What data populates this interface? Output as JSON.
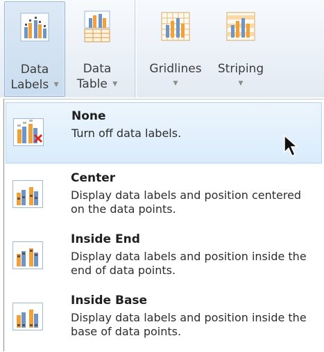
{
  "ribbon": {
    "data_labels": {
      "line1": "Data",
      "line2": "Labels",
      "icon": "data-labels-icon"
    },
    "data_table": {
      "line1": "Data",
      "line2": "Table",
      "icon": "data-table-icon"
    },
    "gridlines": {
      "label": "Gridlines",
      "icon": "gridlines-icon"
    },
    "striping": {
      "label": "Striping",
      "icon": "striping-icon"
    },
    "dropdown_glyph": "▼"
  },
  "menu": {
    "items": [
      {
        "title": "None",
        "description": "Turn off data labels.",
        "icon": "no-labels-icon",
        "selected": true
      },
      {
        "title": "Center",
        "description": "Display data labels and position centered on the data points.",
        "icon": "center-labels-icon",
        "selected": false
      },
      {
        "title": "Inside End",
        "description": "Display data labels and position inside the end of data points.",
        "icon": "inside-end-labels-icon",
        "selected": false
      },
      {
        "title": "Inside Base",
        "description": "Display data labels and position inside the base of data points.",
        "icon": "inside-base-labels-icon",
        "selected": false
      }
    ]
  },
  "colors": {
    "bar_orange": "#f2a13a",
    "bar_blue": "#6f95c7",
    "selection_border": "#b6d5f5",
    "cancel_red": "#d62a1e"
  }
}
